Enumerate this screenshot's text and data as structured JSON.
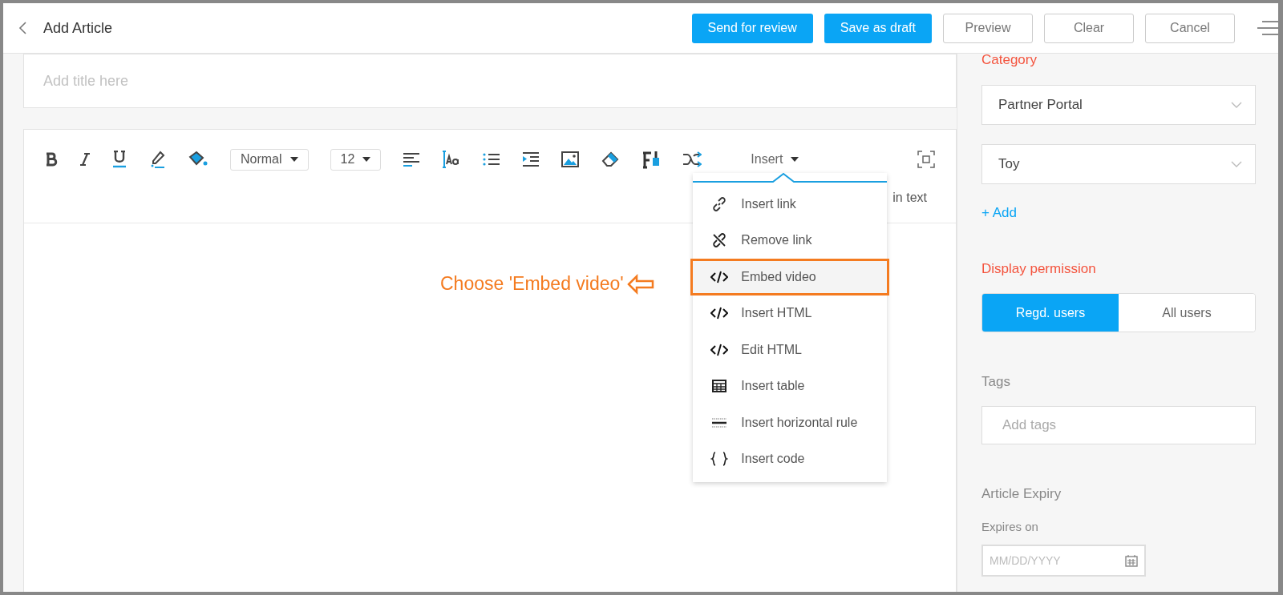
{
  "header": {
    "title": "Add Article",
    "buttons": [
      {
        "label": "Send for review",
        "kind": "primary"
      },
      {
        "label": "Save as draft",
        "kind": "primary"
      },
      {
        "label": "Preview",
        "kind": "secondary"
      },
      {
        "label": "Clear",
        "kind": "secondary"
      },
      {
        "label": "Cancel",
        "kind": "secondary"
      }
    ]
  },
  "title_field": {
    "placeholder": "Add title here"
  },
  "toolbar": {
    "style_select": "Normal",
    "size_select": "12",
    "insert_menu": {
      "label": "Insert",
      "expanded": true,
      "items": [
        {
          "label": "Insert link",
          "highlighted": false
        },
        {
          "label": "Remove link",
          "highlighted": false
        },
        {
          "label": "Embed video",
          "highlighted": true
        },
        {
          "label": "Insert HTML",
          "highlighted": false
        },
        {
          "label": "Edit HTML",
          "highlighted": false
        },
        {
          "label": "Insert table",
          "highlighted": false
        },
        {
          "label": "Insert horizontal rule",
          "highlighted": false
        },
        {
          "label": "Insert code",
          "highlighted": false
        }
      ]
    }
  },
  "editor": {
    "hidden_text": "in text"
  },
  "annotation": "Choose 'Embed video'",
  "sidebar": {
    "category_label": "Category",
    "selects": [
      "Partner Portal",
      "Toy"
    ],
    "add_link": "+ Add",
    "permission_label": "Display permission",
    "permissions": [
      {
        "label": "Regd. users",
        "selected": true
      },
      {
        "label": "All users",
        "selected": false
      }
    ],
    "tags_label": "Tags",
    "tags_placeholder": "Add tags",
    "expiry_label": "Article Expiry",
    "expires_on": "Expires on",
    "date_placeholder": "MM/DD/YYYY"
  }
}
